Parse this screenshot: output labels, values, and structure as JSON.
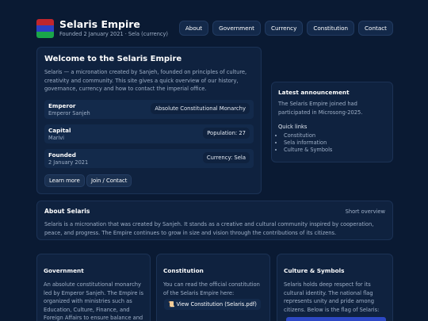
{
  "header": {
    "title": "Selaris Empire",
    "subtitle": "Founded 2 January 2021 · Sela (currency)",
    "flag_colors": [
      "#c0262d",
      "#2d3fc4",
      "#1aa64a"
    ]
  },
  "nav": {
    "items": [
      "About",
      "Government",
      "Currency",
      "Constitution",
      "Contact"
    ]
  },
  "welcome": {
    "title": "Welcome to the Selaris Empire",
    "body": "Selaris — a micronation created by Sanjeh, founded on principles of culture, creativity and community. This site gives a quick overview of our history, governance, currency and how to contact the imperial office.",
    "rows": [
      {
        "label": "Emperor",
        "sub": "Emperor Sanjeh",
        "value": "Absolute Constitutional Monarchy"
      },
      {
        "label": "Capital",
        "sub": "Marivi",
        "value": "Population: 27"
      },
      {
        "label": "Founded",
        "sub": "2 January 2021",
        "value": "Currency: Sela"
      }
    ],
    "learn_more": "Learn more",
    "join": "Join / Contact"
  },
  "announcement": {
    "title": "Latest announcement",
    "body": "The Selaris Empire joined had participated in Microsong-2025.",
    "links_title": "Quick links",
    "links": [
      "Constitution",
      "Sela information",
      "Culture & Symbols"
    ]
  },
  "about": {
    "title": "About Selaris",
    "tag": "Short overview",
    "body": "Selaris is a micronation that was created by Sanjeh. It stands as a creative and cultural community inspired by cooperation, peace, and progress. The Empire continues to grow in size and vision through the contributions of its citizens."
  },
  "government": {
    "title": "Government",
    "body": "An absolute constitutional monarchy led by Emperor Sanjeh. The Empire is organized with ministries such as Education, Culture, Finance, and Foreign Affairs to ensure balance and prosperity for all citizens."
  },
  "constitution": {
    "title": "Constitution",
    "body": "You can read the official constitution of the Selaris Empire here:",
    "link": "View Constitution (Selaris.pdf)",
    "link_icon": "scroll-icon"
  },
  "culture": {
    "title": "Culture & Symbols",
    "body": "Selaris holds deep respect for its cultural identity. The national flag represents unity and pride among citizens. Below is the flag of Selaris:",
    "flag_color": "#2d48c4"
  }
}
